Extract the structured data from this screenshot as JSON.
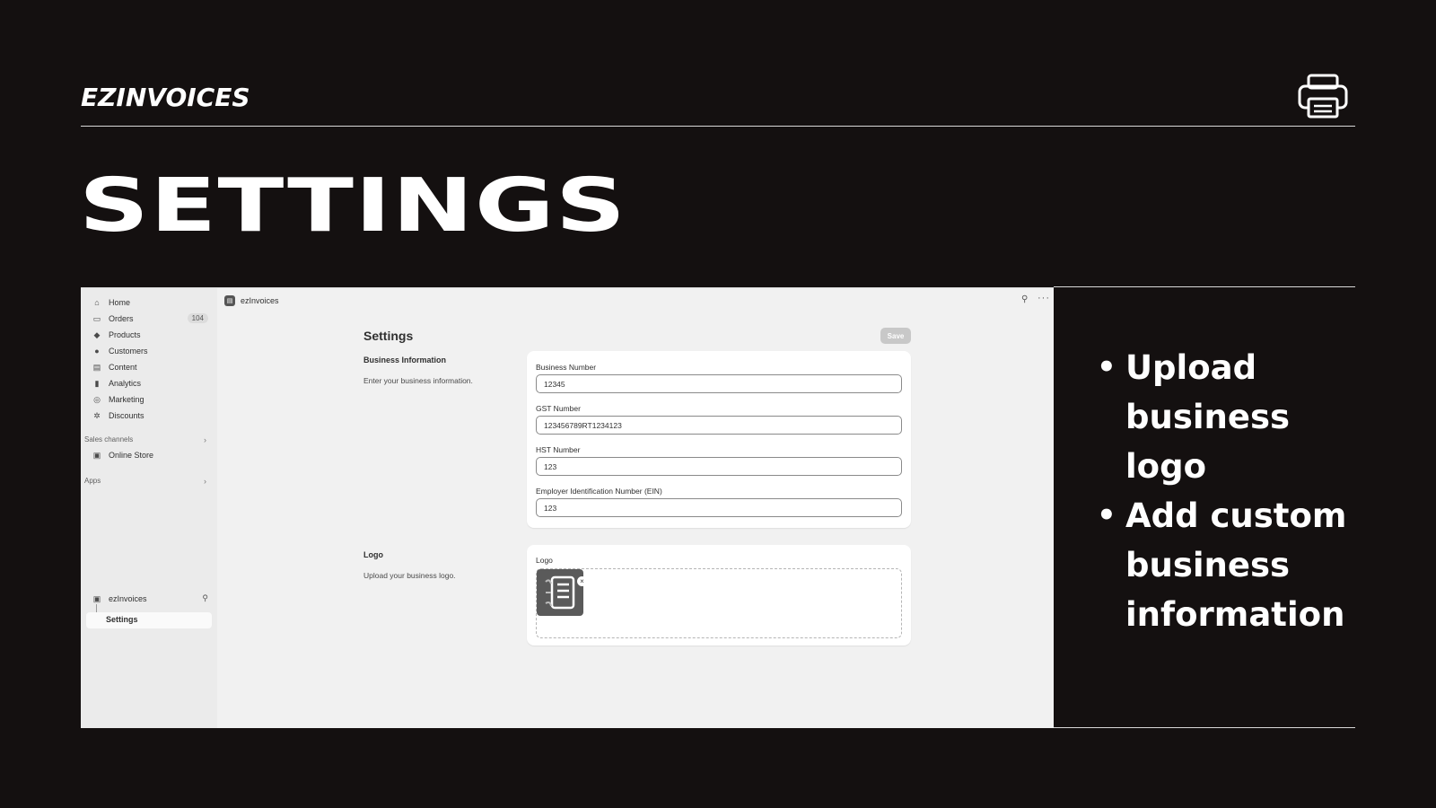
{
  "brand": "EZINVOICES",
  "page_title": "SETTINGS",
  "bullets": [
    "Upload business logo",
    "Add custom business information"
  ],
  "screenshot": {
    "sidebar": {
      "items": [
        {
          "label": "Home",
          "icon": "home-icon"
        },
        {
          "label": "Orders",
          "icon": "inbox-icon",
          "badge": "104"
        },
        {
          "label": "Products",
          "icon": "tag-icon"
        },
        {
          "label": "Customers",
          "icon": "person-icon"
        },
        {
          "label": "Content",
          "icon": "content-icon"
        },
        {
          "label": "Analytics",
          "icon": "bar-chart-icon"
        },
        {
          "label": "Marketing",
          "icon": "target-icon"
        },
        {
          "label": "Discounts",
          "icon": "discount-icon"
        }
      ],
      "sales_channels_label": "Sales channels",
      "online_store_label": "Online Store",
      "apps_label": "Apps",
      "app_label": "ezInvoices",
      "settings_label": "Settings"
    },
    "topbar": {
      "app_name": "ezInvoices"
    },
    "main": {
      "title": "Settings",
      "save_label": "Save",
      "business_section": {
        "title": "Business Information",
        "description": "Enter your business information.",
        "fields": [
          {
            "label": "Business Number",
            "value": "12345"
          },
          {
            "label": "GST Number",
            "value": "123456789RT1234123"
          },
          {
            "label": "HST Number",
            "value": "123"
          },
          {
            "label": "Employer Identification Number (EIN)",
            "value": "123"
          }
        ]
      },
      "logo_section": {
        "title": "Logo",
        "description": "Upload your business logo.",
        "field_label": "Logo"
      }
    }
  }
}
